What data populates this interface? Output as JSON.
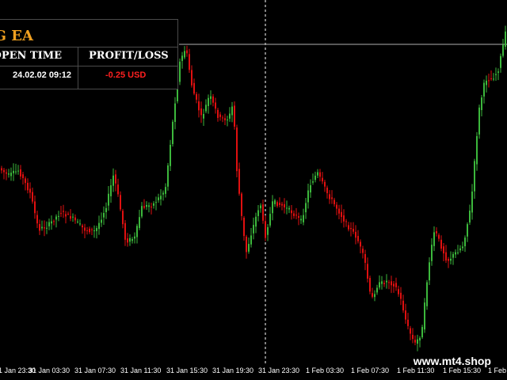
{
  "panel": {
    "title": "G EA",
    "headers": [
      "OPEN TIME",
      "PROFIT/LOSS"
    ],
    "open_time": "24.02.02 09:12",
    "profit_loss": "-0.25 USD"
  },
  "x_axis_ticks": [
    "1 Jan 23:30",
    "31 Jan 03:30",
    "31 Jan 07:30",
    "31 Jan 11:30",
    "31 Jan 15:30",
    "31 Jan 19:30",
    "31 Jan 23:30",
    "1 Feb 03:30",
    "1 Feb 07:30",
    "1 Feb 11:30",
    "1 Feb 15:30",
    "1 Feb"
  ],
  "watermark": "www.mt4.shop",
  "colors": {
    "background": "#000000",
    "bull_candle": "#3cb83c",
    "bear_candle": "#e01010",
    "title": "#f0a020",
    "loss_text": "#ff2020",
    "grid_line": "#b0b0b0"
  }
}
